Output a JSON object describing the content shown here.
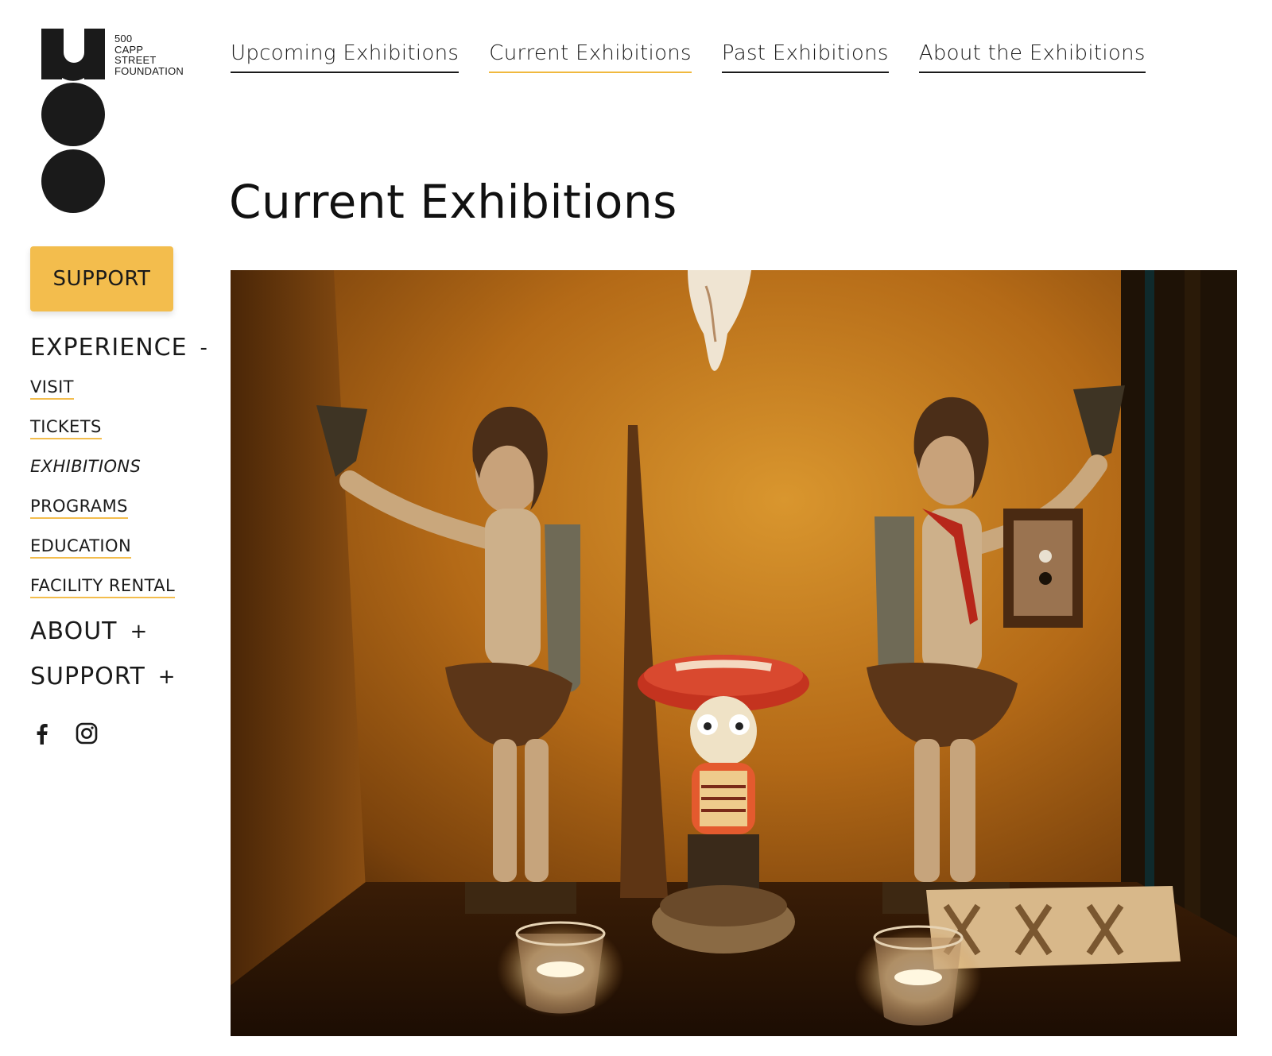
{
  "logo": {
    "lines": [
      "500",
      "CAPP",
      "STREET",
      "FOUNDATION"
    ]
  },
  "top_nav": [
    {
      "label": "Upcoming Exhibitions",
      "active": false
    },
    {
      "label": "Current Exhibitions",
      "active": true
    },
    {
      "label": "Past Exhibitions",
      "active": false
    },
    {
      "label": "About the Exhibitions",
      "active": false
    }
  ],
  "page_title": "Current Exhibitions",
  "support_button": "SUPPORT",
  "side_nav": {
    "experience": {
      "label": "EXPERIENCE",
      "toggle": "-"
    },
    "items": [
      "VISIT",
      "TICKETS",
      "EXHIBITIONS",
      "PROGRAMS",
      "EDUCATION",
      "FACILITY RENTAL"
    ],
    "current_item": "EXHIBITIONS",
    "about": {
      "label": "ABOUT",
      "toggle": "+"
    },
    "support": {
      "label": "SUPPORT",
      "toggle": "+"
    }
  },
  "social": {
    "icons": [
      "facebook-icon",
      "instagram-icon"
    ]
  },
  "colors": {
    "accent": "#f3bd4d",
    "text": "#1a1a1a",
    "background": "#ffffff"
  }
}
